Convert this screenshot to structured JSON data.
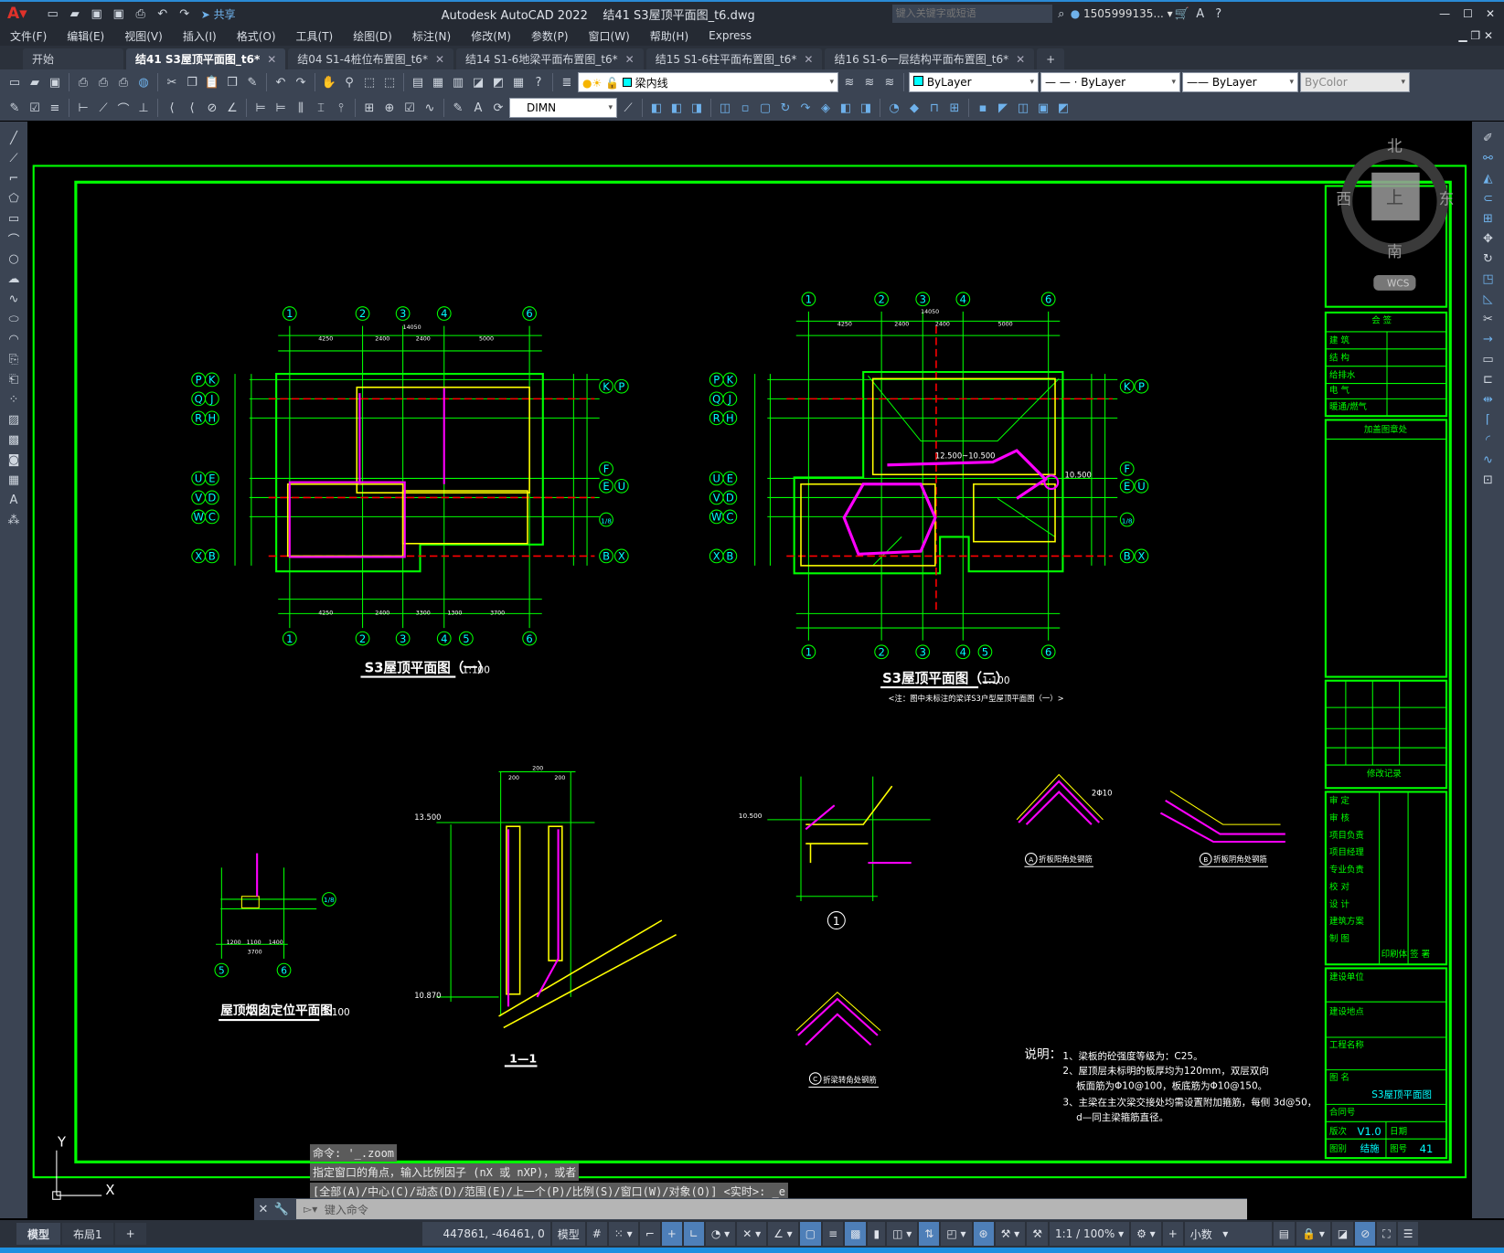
{
  "app": {
    "title": "Autodesk AutoCAD 2022",
    "file": "结41 S3屋顶平面图_t6.dwg",
    "share": "共享",
    "search_placeholder": "键入关键字或短语",
    "user": "1505999135...",
    "menus": [
      "文件(F)",
      "编辑(E)",
      "视图(V)",
      "插入(I)",
      "格式(O)",
      "工具(T)",
      "绘图(D)",
      "标注(N)",
      "修改(M)",
      "参数(P)",
      "窗口(W)",
      "帮助(H)",
      "Express"
    ]
  },
  "tabs": [
    {
      "label": "开始",
      "closable": false,
      "active": false
    },
    {
      "label": "结41 S3屋顶平面图_t6*",
      "closable": true,
      "active": true
    },
    {
      "label": "结04 S1-4桩位布置图_t6*",
      "closable": true,
      "active": false
    },
    {
      "label": "结14 S1-6地梁平面布置图_t6*",
      "closable": true,
      "active": false
    },
    {
      "label": "结15 S1-6柱平面布置图_t6*",
      "closable": true,
      "active": false
    },
    {
      "label": "结16 S1-6一层结构平面布置图_t6*",
      "closable": true,
      "active": false
    }
  ],
  "toolbar": {
    "layer": "梁内线",
    "color": "ByLayer",
    "linetype": "ByLayer",
    "lineweight": "ByLayer",
    "plotstyle": "ByColor",
    "dimstyle": "DIMN"
  },
  "viewcube": {
    "north": "北",
    "south": "南",
    "east": "东",
    "west": "西",
    "top": "上",
    "wcs": "WCS"
  },
  "ucs": {
    "x": "X",
    "y": "Y"
  },
  "drawing": {
    "plan1": {
      "title": "S3屋顶平面图（一）",
      "scale": "1:100",
      "top_axes": [
        "1",
        "2",
        "3",
        "4",
        "6"
      ],
      "bottom_axes": [
        "1",
        "2",
        "3",
        "4",
        "5",
        "6"
      ],
      "left_axes": [
        "P",
        "K",
        "Q",
        "J",
        "R",
        "H",
        "U",
        "E",
        "V",
        "D",
        "W",
        "C",
        "X",
        "B"
      ],
      "right_axes": [
        "K",
        "P",
        "F",
        "E",
        "U",
        "1/8",
        "B",
        "X"
      ],
      "dims_top": [
        "4250",
        "2400",
        "2400",
        "5000"
      ],
      "dim_total": "14050",
      "dims_bottom": [
        "4250",
        "2400",
        "3300",
        "1300",
        "3700"
      ]
    },
    "plan2": {
      "title": "S3屋顶平面图（二）",
      "scale": "1:100",
      "note": "<注：图中未标注的梁详S3户型屋顶平面图（一）>",
      "top_axes": [
        "1",
        "2",
        "3",
        "4",
        "6"
      ],
      "bottom_axes": [
        "1",
        "2",
        "3",
        "4",
        "5",
        "6"
      ],
      "left_axes": [
        "P",
        "K",
        "Q",
        "J",
        "R",
        "H",
        "U",
        "E",
        "V",
        "D",
        "W",
        "C",
        "X",
        "B"
      ],
      "right_axes": [
        "K",
        "P",
        "F",
        "E",
        "U",
        "1/8",
        "B",
        "X"
      ],
      "dims_top": [
        "4250",
        "2400",
        "2400",
        "5000"
      ],
      "dim_total": "14050",
      "elev1": "12.500~10.500",
      "elev2": "10.500"
    },
    "chimney": {
      "title": "屋顶烟囱定位平面图",
      "scale": "1:100",
      "axes": [
        "5",
        "6"
      ],
      "axis_right": "1/8",
      "dims": [
        "1200",
        "1100",
        "1400"
      ],
      "dim_total": "3700"
    },
    "section": {
      "title": "1—1",
      "elev_top": "13.500",
      "elev_bottom": "10.870",
      "dims": [
        "200",
        "200",
        "200"
      ]
    },
    "detail1": {
      "label": "1",
      "elev": "10.500"
    },
    "detailA": {
      "label": "A",
      "caption": "折板阳角处钢筋",
      "bar": "2Φ10"
    },
    "detailB": {
      "label": "B",
      "caption": "折板阴角处钢筋"
    },
    "detailC": {
      "label": "C",
      "caption": "折梁转角处钢筋"
    },
    "notes": {
      "heading": "说明：",
      "lines": [
        "1、梁板的砼强度等级为：C25。",
        "2、屋顶层未标明的板厚均为120mm，双层双向",
        "板面筋为Φ10@100，板底筋为Φ10@150。",
        "3、主梁在主次梁交接处均需设置附加箍筋，每侧 3d@50，",
        "d—同主梁箍筋直径。"
      ]
    },
    "titleblock": {
      "countersign": "会 签",
      "countersign_rows": [
        "建 筑",
        "结 构",
        "给排水",
        "电 气",
        "暖通/燃气"
      ],
      "stamp": "加盖图章处",
      "revision": "修改记录",
      "roles": [
        "审 定",
        "审 核",
        "项目负责",
        "项目经理",
        "专业负责",
        "校 对",
        "设 计",
        "建筑方案",
        "制 图"
      ],
      "print": "印刷体",
      "signature": "签 署",
      "client": "建设单位",
      "site": "建设地点",
      "project": "工程名称",
      "title_label": "图 名",
      "title_value": "S3屋顶平面图",
      "contract": "合同号",
      "version_label": "版次",
      "version": "V1.0",
      "date_label": "日期",
      "type_label": "图别",
      "type": "结施",
      "number_label": "图号",
      "number": "41"
    }
  },
  "command": {
    "history": [
      "命令: '_.zoom",
      "指定窗口的角点，输入比例因子 (nX 或 nXP)，或者",
      "[全部(A)/中心(C)/动态(D)/范围(E)/上一个(P)/比例(S)/窗口(W)/对象(O)] <实时>: _e"
    ],
    "placeholder": "键入命令"
  },
  "layout_tabs": [
    "模型",
    "布局1"
  ],
  "status": {
    "coords": "447861, -46461, 0",
    "space": "模型",
    "scale": "1:1 / 100%",
    "units": "小数"
  },
  "colors": {
    "green": "#00ff00",
    "cyan": "#00ffff",
    "yellow": "#ffff00",
    "magenta": "#ff00ff",
    "red": "#ff0000",
    "accent": "#1e90e0"
  }
}
